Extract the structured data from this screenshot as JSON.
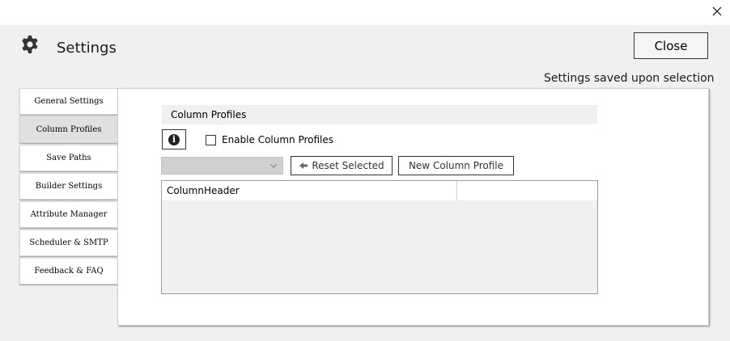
{
  "window": {
    "close_icon": "close-icon"
  },
  "header": {
    "title": "Settings",
    "icon": "gear-icon",
    "close_label": "Close"
  },
  "status": {
    "saved_note": "Settings saved upon selection"
  },
  "tabs": [
    {
      "label": "General Settings"
    },
    {
      "label": "Column Profiles",
      "active": true
    },
    {
      "label": "Save Paths"
    },
    {
      "label": "Builder Settings"
    },
    {
      "label": "Attribute Manager"
    },
    {
      "label": "Scheduler & SMTP"
    },
    {
      "label": "Feedback & FAQ"
    }
  ],
  "panel": {
    "section_title": "Column Profiles",
    "info_icon": "info-icon",
    "enable_label": "Enable Column Profiles",
    "enable_checked": false,
    "profile_select_value": "",
    "reset_label": "Reset Selected",
    "new_label": "New Column Profile",
    "grid": {
      "columns": [
        "ColumnHeader",
        ""
      ],
      "rows": []
    }
  }
}
